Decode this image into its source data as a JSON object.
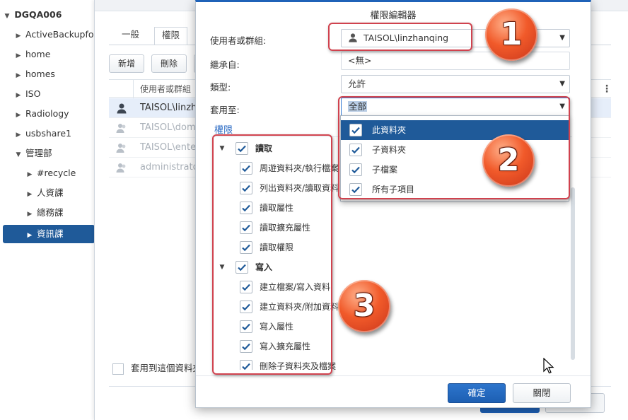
{
  "tree": {
    "root": "DGQA006",
    "items": [
      {
        "label": "ActiveBackupfor"
      },
      {
        "label": "home"
      },
      {
        "label": "homes"
      },
      {
        "label": "ISO"
      },
      {
        "label": "Radiology"
      },
      {
        "label": "usbshare1"
      },
      {
        "label": "管理部"
      },
      {
        "label": "#recycle"
      },
      {
        "label": "人資課"
      },
      {
        "label": "總務課"
      },
      {
        "label": "資訊課"
      }
    ]
  },
  "background_panel": {
    "tabs": [
      "一般",
      "權限"
    ],
    "buttons": [
      "新增",
      "刪除"
    ],
    "column_header": "使用者或群組",
    "rows": [
      {
        "name": "TAISOL\\linzha"
      },
      {
        "name": "TAISOL\\doma"
      },
      {
        "name": "TAISOL\\enter"
      },
      {
        "name": "administrator"
      }
    ],
    "apply_label": "套用到這個資料夾"
  },
  "dialog": {
    "title": "權限編輯器",
    "user_label": "使用者或群組:",
    "user_value": "TAISOL\\linzhanqing",
    "inherit_label": "繼承自:",
    "inherit_value": "<無>",
    "type_label": "類型:",
    "type_value": "允許",
    "apply_label": "套用至:",
    "apply_value": "全部",
    "perm_title": "權限",
    "read": {
      "label": "讀取",
      "children": [
        "周遊資料夾/執行檔案",
        "列出資料夾/讀取資料",
        "讀取屬性",
        "讀取擴充屬性",
        "讀取權限"
      ]
    },
    "write": {
      "label": "寫入",
      "children": [
        "建立檔案/寫入資料",
        "建立資料夾/附加資料",
        "寫入屬性",
        "寫入擴充屬性",
        "刪除子資料夾及檔案"
      ]
    },
    "dropdown_options": [
      "此資料夾",
      "子資料夾",
      "子檔案",
      "所有子項目"
    ],
    "ok_label": "確定",
    "close_label": "關閉"
  },
  "annotations": {
    "badges": [
      "1",
      "2",
      "3"
    ]
  },
  "colors": {
    "accent": "#1f62b8",
    "selected": "#1f5a99",
    "annotation": "#d0424e",
    "badge": "#f15a2a"
  }
}
